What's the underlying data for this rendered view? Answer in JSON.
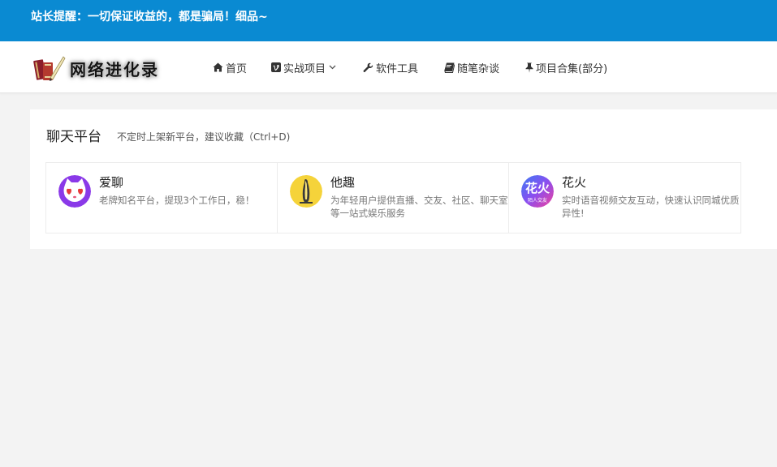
{
  "notice": {
    "text": "站长提醒：一切保证收益的，都是骗局！细品~"
  },
  "header": {
    "logo_text": "网络进化录",
    "nav": [
      {
        "label": "首页",
        "icon": "home-icon"
      },
      {
        "label": "实战项目",
        "icon": "vimeo-icon",
        "has_dropdown": true
      },
      {
        "label": "软件工具",
        "icon": "wrench-icon"
      },
      {
        "label": "随笔杂谈",
        "icon": "book-icon"
      },
      {
        "label": "项目合集(部分)",
        "icon": "pin-icon"
      }
    ]
  },
  "section": {
    "title": "聊天平台",
    "subtitle": "不定时上架新平台，建议收藏（Ctrl+D)",
    "items": [
      {
        "name": "爱聊",
        "desc": "老牌知名平台，提现3个工作日，稳！",
        "icon": "cat-face-icon"
      },
      {
        "name": "他趣",
        "desc": "为年轻用户提供直播、交友、社区、聊天室等一站式娱乐服务",
        "icon": "banana-icon"
      },
      {
        "name": "花火",
        "desc": "实时语音视频交友互动，快速认识同城优质异性!",
        "icon": "huahuo-logo-icon",
        "logo_text": "花火",
        "logo_subtext": "陌人交友"
      }
    ]
  },
  "colors": {
    "notice_bg": "#0a8ad2",
    "page_bg": "#f3f3f3",
    "panel_bg": "#ffffff"
  }
}
